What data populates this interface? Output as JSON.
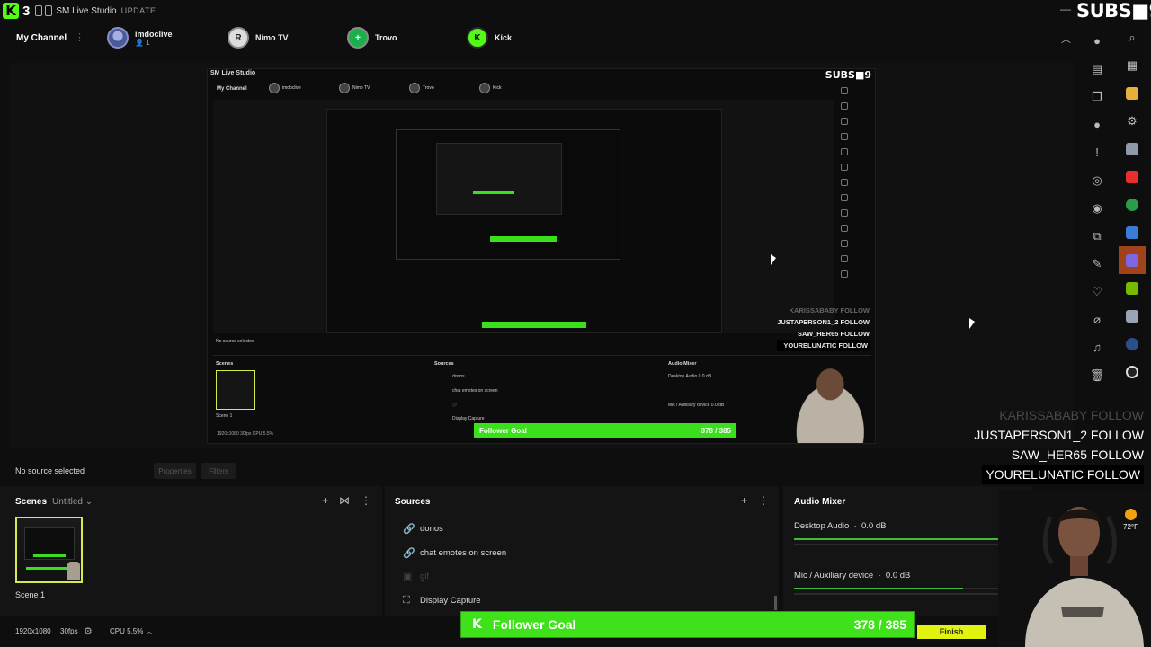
{
  "app": {
    "logo_number": "3",
    "title": "SM Live Studio",
    "update_label": "UPDATE",
    "subs_counter": "SUBS■9"
  },
  "channels": {
    "my_channel_label": "My Channel",
    "items": [
      {
        "name": "imdoclive",
        "sub": "1",
        "icon": "user-avatar"
      },
      {
        "name": "Nimo TV",
        "icon": "nimo-tv-icon",
        "initial": "R"
      },
      {
        "name": "Trovo",
        "icon": "trovo-icon",
        "initial": "+"
      },
      {
        "name": "Kick",
        "icon": "kick-icon",
        "initial": "K"
      }
    ]
  },
  "nested_preview": {
    "title": "SM Live Studio",
    "subs": "SUBS■9",
    "my_channel": "My Channel",
    "channels": [
      "imdoclive",
      "Nimo TV",
      "Trovo",
      "Kick"
    ],
    "feed": [
      {
        "text": "KARISSABABY  FOLLOW",
        "style": "dim"
      },
      {
        "text": "JUSTAPERSON1_2  FOLLOW",
        "style": "normal"
      },
      {
        "text": "SAW_HER65  FOLLOW",
        "style": "normal"
      },
      {
        "text": "YOURELUNATIC  FOLLOW",
        "style": "hl"
      }
    ],
    "no_source": "No source selected",
    "scenes": "Scenes",
    "scenes_sub": "Untitled",
    "scene_label": "Scene 1",
    "sources": "Sources",
    "source_items": [
      "donos",
      "chat emotes on screen",
      "gif",
      "Display Capture"
    ],
    "audio_mixer": "Audio Mixer",
    "desktop_audio": "Desktop Audio   0.0 dB",
    "mic": "Mic / Auxiliary device   0.0 dB",
    "goal_label": "Follower Goal",
    "goal_value": "378 / 385",
    "finish": "Finish",
    "status": "1920x1080   30fps         CPU 5.5%"
  },
  "feed": [
    {
      "text": "KARISSABABY  FOLLOW",
      "style": "dim"
    },
    {
      "text": "JUSTAPERSON1_2  FOLLOW",
      "style": "normal"
    },
    {
      "text": "SAW_HER65  FOLLOW",
      "style": "normal"
    },
    {
      "text": "YOURELUNATIC  FOLLOW",
      "style": "hl"
    }
  ],
  "source_bar": {
    "no_source": "No source selected",
    "properties": "Properties",
    "filters": "Filters"
  },
  "scenes": {
    "title": "Scenes",
    "collection": "Untitled",
    "scene_name": "Scene 1"
  },
  "sources": {
    "title": "Sources",
    "items": [
      {
        "name": "donos",
        "icon": "link-icon"
      },
      {
        "name": "chat emotes on screen",
        "icon": "link-icon"
      },
      {
        "name": "gif",
        "icon": "image-icon"
      },
      {
        "name": "Display Capture",
        "icon": "display-capture-icon"
      }
    ]
  },
  "audio_mixer": {
    "title": "Audio Mixer",
    "channels": [
      {
        "name": "Desktop Audio",
        "db": "0.0 dB",
        "level": 0.98
      },
      {
        "name": "Mic / Auxiliary device",
        "db": "0.0 dB",
        "level": 0.75
      }
    ]
  },
  "status": {
    "resolution": "1920x1080",
    "fps": "30fps",
    "cpu": "CPU 5.5%"
  },
  "follower_goal": {
    "label": "Follower Goal",
    "current": 378,
    "target": 385,
    "display": "378 / 385",
    "finish_label": "Finish"
  },
  "weather": {
    "temp": "72°F"
  },
  "colors": {
    "accent_green": "#53fc18",
    "goal_green": "#3fe11b",
    "finish_yellow": "#e1f30f",
    "scene_border": "#d9e84d"
  }
}
